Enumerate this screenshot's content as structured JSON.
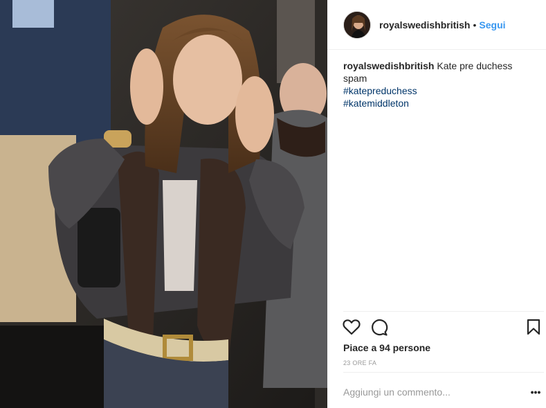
{
  "post": {
    "username": "royalswedishbritish",
    "separator": "•",
    "follow_label": "Segui",
    "caption_user": "royalswedishbritish",
    "caption_text": "Kate pre duchess spam",
    "hashtags": [
      "#katepreduchess",
      "#katemiddleton"
    ],
    "likes_prefix": "Piace a",
    "likes_count": "94",
    "likes_suffix": "persone",
    "timestamp": "23 ORE FA",
    "comment_placeholder": "Aggiungi un commento...",
    "more_label": "•••"
  },
  "icons": {
    "like": "heart-icon",
    "comment": "comment-bubble-icon",
    "save": "bookmark-icon",
    "more": "ellipsis-icon"
  },
  "colors": {
    "link_blue": "#3897f0",
    "hashtag_blue": "#003569",
    "muted_text": "#999999",
    "divider": "#efefef"
  }
}
